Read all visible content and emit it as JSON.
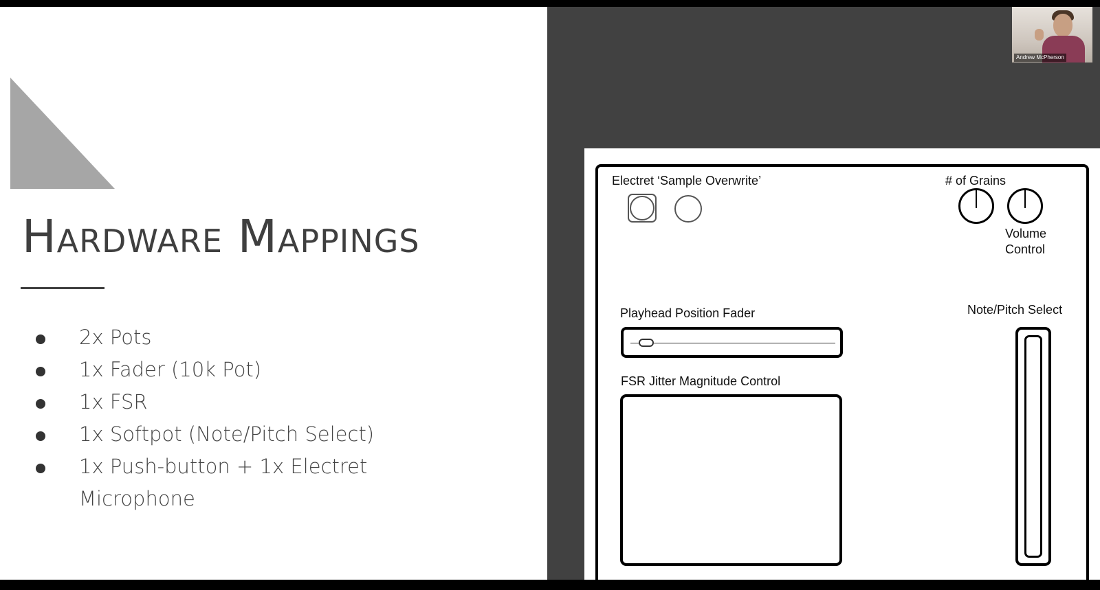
{
  "slide": {
    "title": "Hardware Mappings",
    "bullets": [
      "2x Pots",
      "1x Fader (10k Pot)",
      "1x FSR",
      "1x Softpot (Note/Pitch Select)",
      "1x Push-button + 1x Electret Microphone"
    ],
    "colors": {
      "left_bg": "#ffffff",
      "right_bg": "#414141",
      "triangle": "#a6a6a6",
      "text": "#3f3f3f"
    }
  },
  "diagram": {
    "electret_label": "Electret ‘Sample Overwrite’",
    "grains_label": "# of Grains",
    "volume_label_line1": "Volume",
    "volume_label_line2": "Control",
    "playhead_label": "Playhead Position Fader",
    "fsr_label": "FSR Jitter Magnitude Control",
    "note_label": "Note/Pitch Select"
  },
  "video": {
    "participant_name": "Andrew McPherson"
  }
}
